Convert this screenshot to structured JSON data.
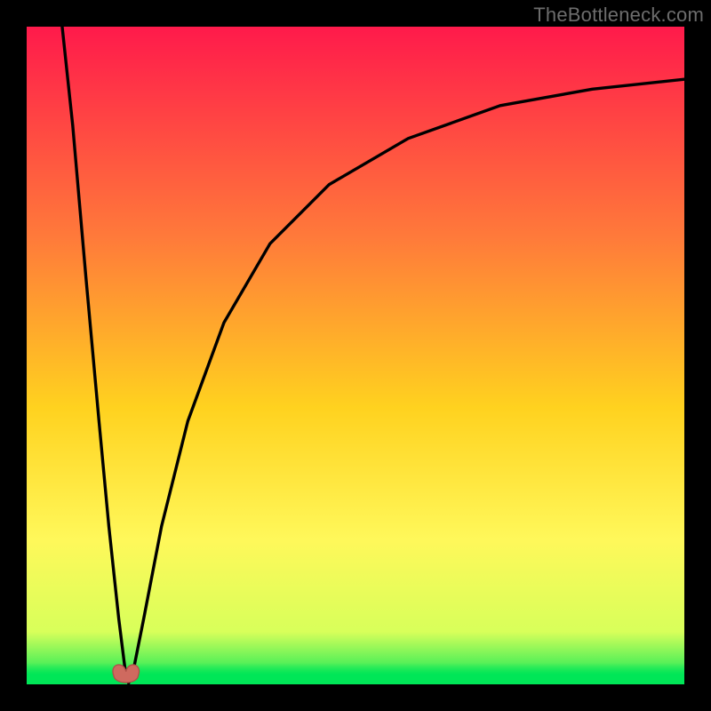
{
  "watermark": {
    "text": "TheBottleneck.com"
  },
  "colors": {
    "background": "#000000",
    "gradient_top": "#ff1a4b",
    "gradient_mid_upper": "#ff7a3a",
    "gradient_mid": "#ffd21f",
    "gradient_mid_lower": "#fff85a",
    "gradient_lower": "#d8ff5a",
    "gradient_bottom": "#00e657",
    "curve": "#000000",
    "marker_fill": "#cf6a5f",
    "marker_stroke": "#b05048"
  },
  "chart_data": {
    "type": "line",
    "title": "",
    "xlabel": "",
    "ylabel": "",
    "xlim": [
      0,
      100
    ],
    "ylim": [
      0,
      100
    ],
    "note": "Stylized bottleneck curve: sharp V dip to ~0 near x≈15.5, then asymptotic rise toward ~92 as x→100. No axis tick labels are shown in the image; values below are read off relative to the plot-area (0–100 each axis).",
    "curve": {
      "left_branch": [
        {
          "x": 5.4,
          "y": 100.0
        },
        {
          "x": 7.0,
          "y": 85.0
        },
        {
          "x": 9.0,
          "y": 62.0
        },
        {
          "x": 11.0,
          "y": 40.0
        },
        {
          "x": 12.5,
          "y": 24.0
        },
        {
          "x": 14.0,
          "y": 10.0
        },
        {
          "x": 15.0,
          "y": 2.0
        },
        {
          "x": 15.5,
          "y": 0.2
        }
      ],
      "right_branch": [
        {
          "x": 15.5,
          "y": 0.2
        },
        {
          "x": 16.2,
          "y": 2.0
        },
        {
          "x": 17.8,
          "y": 10.0
        },
        {
          "x": 20.5,
          "y": 24.0
        },
        {
          "x": 24.5,
          "y": 40.0
        },
        {
          "x": 30.0,
          "y": 55.0
        },
        {
          "x": 37.0,
          "y": 67.0
        },
        {
          "x": 46.0,
          "y": 76.0
        },
        {
          "x": 58.0,
          "y": 83.0
        },
        {
          "x": 72.0,
          "y": 88.0
        },
        {
          "x": 86.0,
          "y": 90.5
        },
        {
          "x": 100.0,
          "y": 92.0
        }
      ]
    },
    "marker": {
      "x": 15.1,
      "y": 1.6,
      "shape": "bean"
    },
    "green_band": {
      "y_start": 0.0,
      "y_end": 3.2
    }
  }
}
